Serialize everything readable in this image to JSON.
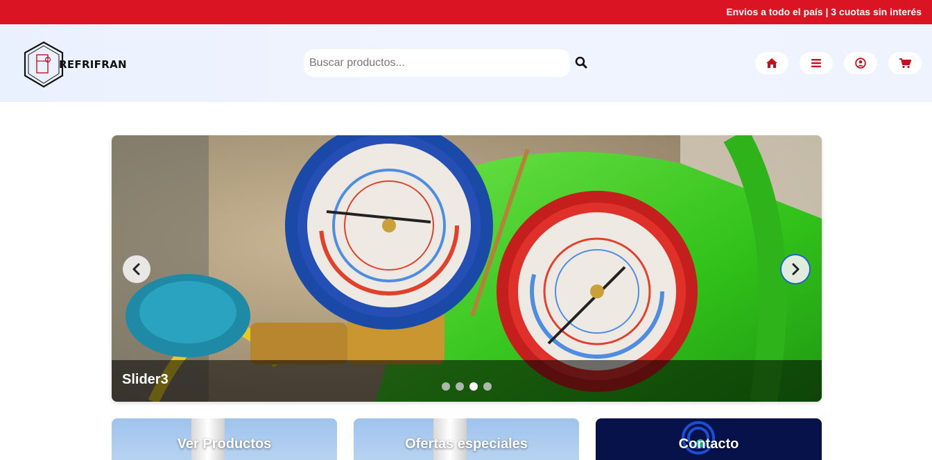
{
  "topbar": {
    "promo": "Envios a todo el país | 3 cuotas sin interés"
  },
  "header": {
    "logo_text": "REFRIFRAN",
    "search_placeholder": "Buscar productos...",
    "nav": [
      {
        "name": "home-button",
        "icon": "home-icon"
      },
      {
        "name": "menu-button",
        "icon": "bars-icon"
      },
      {
        "name": "account-button",
        "icon": "user-circle-icon"
      },
      {
        "name": "cart-button",
        "icon": "shopping-cart-icon"
      }
    ],
    "accent_color": "#db1423"
  },
  "slider": {
    "caption": "Slider3",
    "active_index": 2,
    "slide_count": 4
  },
  "cards": [
    {
      "label": "Ver Productos"
    },
    {
      "label": "Ofertas especiales"
    },
    {
      "label": "Contacto"
    }
  ]
}
